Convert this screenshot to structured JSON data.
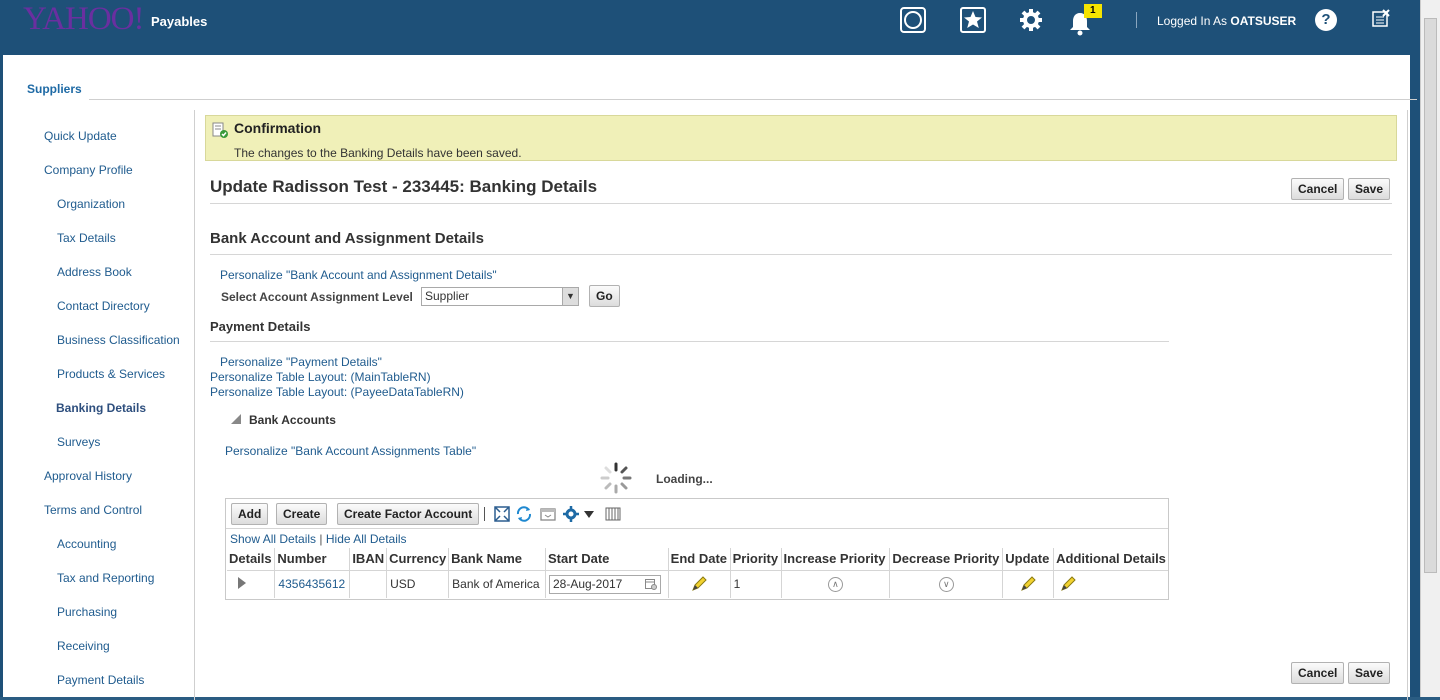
{
  "header": {
    "logo": "YAHOO!",
    "app_name": "Payables",
    "notification_count": "1",
    "logged_in_prefix": "Logged In As",
    "username": "OATSUSER",
    "help": "?"
  },
  "tab": {
    "label": "Suppliers"
  },
  "sidebar": {
    "items": [
      {
        "label": "Quick Update"
      },
      {
        "label": "Company Profile"
      },
      {
        "label": "Organization"
      },
      {
        "label": "Tax Details"
      },
      {
        "label": "Address Book"
      },
      {
        "label": "Contact Directory"
      },
      {
        "label": "Business Classification"
      },
      {
        "label": "Products & Services"
      },
      {
        "label": "Banking Details"
      },
      {
        "label": "Surveys"
      },
      {
        "label": "Approval History"
      },
      {
        "label": "Terms and Control"
      },
      {
        "label": "Accounting"
      },
      {
        "label": "Tax and Reporting"
      },
      {
        "label": "Purchasing"
      },
      {
        "label": "Receiving"
      },
      {
        "label": "Payment Details"
      }
    ]
  },
  "confirmation": {
    "title": "Confirmation",
    "message": "The changes to the Banking Details have been saved."
  },
  "page": {
    "title": "Update Radisson Test - 233445: Banking Details",
    "cancel": "Cancel",
    "save": "Save"
  },
  "bank_section": {
    "heading": "Bank Account and Assignment Details",
    "personalize": "Personalize \"Bank Account and Assignment Details\"",
    "select_label": "Select Account Assignment Level",
    "select_value": "Supplier",
    "go": "Go"
  },
  "payment_section": {
    "heading": "Payment Details",
    "personalize": "Personalize \"Payment Details\"",
    "layout_main": "Personalize Table Layout: (MainTableRN)",
    "layout_payee": "Personalize Table Layout: (PayeeDataTableRN)"
  },
  "bank_accounts": {
    "heading": "Bank Accounts",
    "personalize": "Personalize \"Bank Account Assignments Table\"",
    "loading": "Loading...",
    "toolbar": {
      "add": "Add",
      "create": "Create",
      "create_factor": "Create Factor Account"
    },
    "show_all": "Show All Details",
    "hide_all": "Hide All Details",
    "columns": [
      "Details",
      "Number",
      "IBAN",
      "Currency",
      "Bank Name",
      "Start Date",
      "End Date",
      "Priority",
      "Increase Priority",
      "Decrease Priority",
      "Update",
      "Additional Details"
    ],
    "rows": [
      {
        "number": "4356435612",
        "iban": "",
        "currency": "USD",
        "bank_name": "Bank of America",
        "start_date": "28-Aug-2017",
        "end_date": "",
        "priority": "1"
      }
    ]
  },
  "bottom": {
    "cancel": "Cancel",
    "save": "Save"
  }
}
